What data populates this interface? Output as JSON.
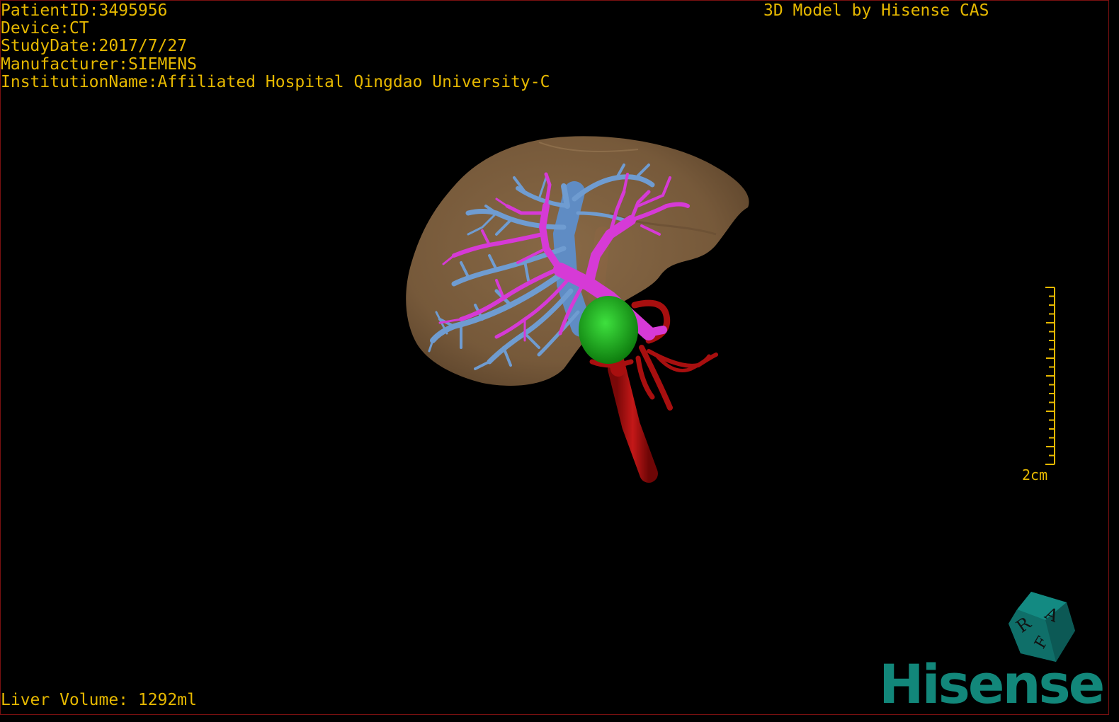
{
  "patient_info": {
    "patient_id": "PatientID:3495956",
    "device": "Device:CT",
    "study_date": "StudyDate:2017/7/27",
    "manufacturer": "Manufacturer:SIEMENS",
    "institution": "InstitutionName:Affiliated Hospital Qingdao University-C"
  },
  "brand_top": "3D Model by Hisense CAS",
  "liver_volume": "Liver Volume: 1292ml",
  "scale_bar": {
    "label": "2cm"
  },
  "orientation_cube": {
    "faces": [
      "R",
      "A",
      "F"
    ]
  },
  "logo": {
    "text": "Hisense"
  },
  "colors": {
    "overlay_text": "#e6b800",
    "liver": "#8a6a45",
    "hepatic_vein": "#6f9cd1",
    "portal_vein": "#d63ad6",
    "artery_aorta": "#b31212",
    "tumor": "#1fb51f",
    "logo": "#12877a",
    "border": "#7a1010"
  }
}
